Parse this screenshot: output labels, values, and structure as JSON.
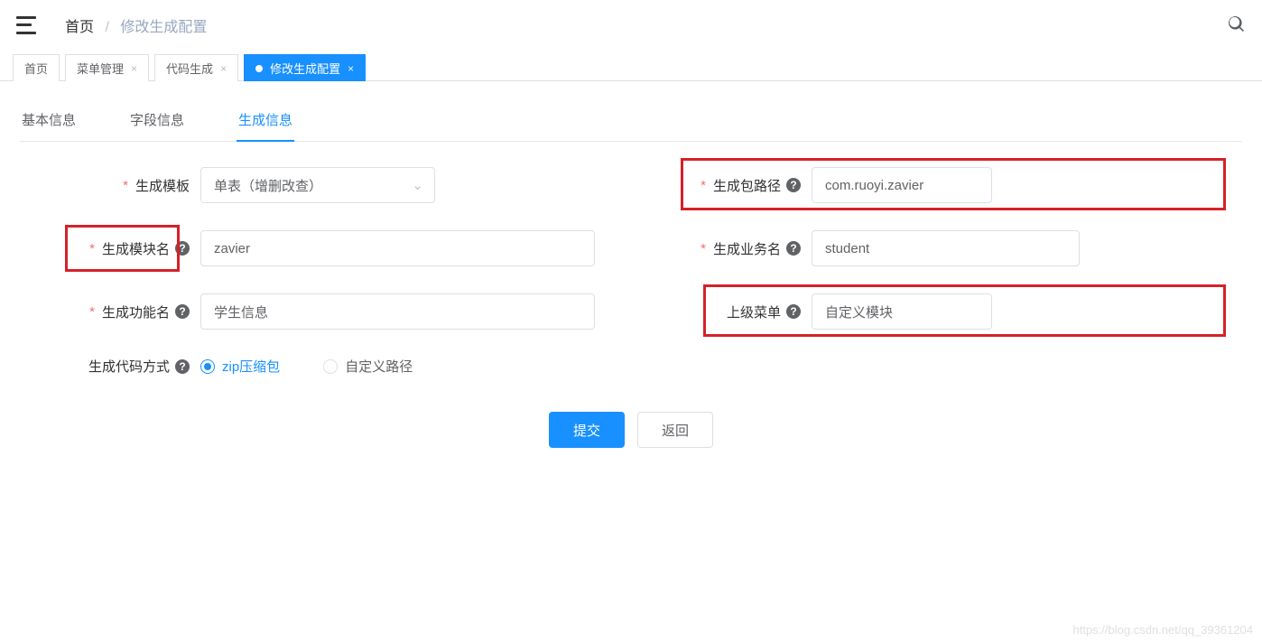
{
  "breadcrumb": {
    "home": "首页",
    "current": "修改生成配置"
  },
  "navTabs": {
    "home": "首页",
    "menu": "菜单管理",
    "codegen": "代码生成",
    "editgen": "修改生成配置"
  },
  "innerTabs": {
    "basic": "基本信息",
    "field": "字段信息",
    "gen": "生成信息"
  },
  "form": {
    "templateLabel": "生成模板",
    "templateValue": "单表（增删改查）",
    "packageLabel": "生成包路径",
    "packageValue": "com.ruoyi.zavier",
    "moduleLabel": "生成模块名",
    "moduleValue": "zavier",
    "businessLabel": "生成业务名",
    "businessValue": "student",
    "functionLabel": "生成功能名",
    "functionValue": "学生信息",
    "parentMenuLabel": "上级菜单",
    "parentMenuValue": "自定义模块",
    "genTypeLabel": "生成代码方式",
    "genTypeZip": "zip压缩包",
    "genTypeCustom": "自定义路径"
  },
  "buttons": {
    "submit": "提交",
    "back": "返回"
  },
  "watermark": "https://blog.csdn.net/qq_39361204"
}
